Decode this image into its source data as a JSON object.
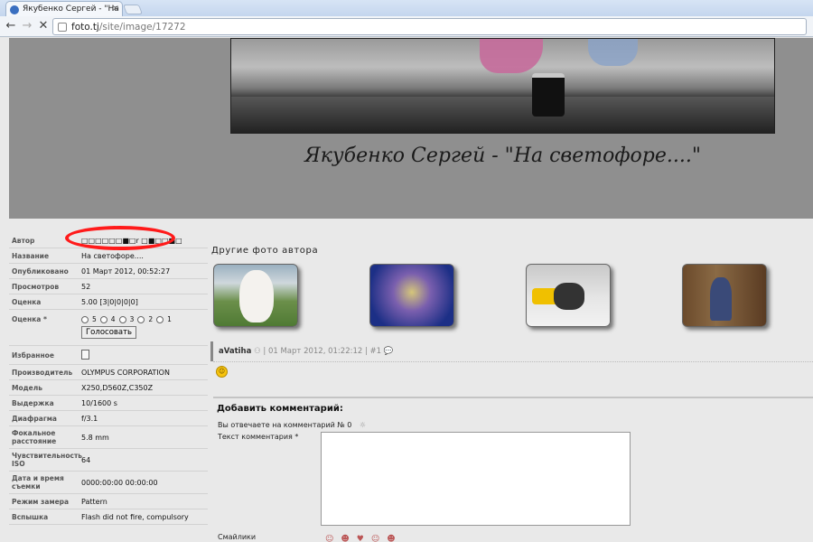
{
  "browser": {
    "tab_title": "Якубенко Сергей - \"На свето",
    "tab_close": "×",
    "url_host": "foto.tj",
    "url_path": "/site/image/17272",
    "back": "←",
    "forward": "→",
    "stop": "✕"
  },
  "banner": {
    "caption": "Якубенко Сергей - \"На светофоре....\""
  },
  "info": {
    "rows": [
      {
        "label": "Автор",
        "value": "□□□□□□■□r □■□□■□"
      },
      {
        "label": "Название",
        "value": "На светофоре...."
      },
      {
        "label": "Опубликовано",
        "value": "01 Март 2012, 00:52:27"
      },
      {
        "label": "Просмотров",
        "value": "52"
      },
      {
        "label": "Оценка",
        "value": "5.00 [3|0|0|0|0]"
      },
      {
        "label": "Оценка *",
        "value": ""
      },
      {
        "label": "Избранное",
        "value": ""
      },
      {
        "label": "Производитель",
        "value": "OLYMPUS CORPORATION"
      },
      {
        "label": "Модель",
        "value": "X250,D560Z,C350Z"
      },
      {
        "label": "Выдержка",
        "value": "10/1600 s"
      },
      {
        "label": "Диафрагма",
        "value": "f/3.1"
      },
      {
        "label": "Фокальное расстояние",
        "value": "5.8 mm"
      },
      {
        "label": "Чувствительность ISO",
        "value": "64"
      },
      {
        "label": "Дата и время съемки",
        "value": "0000:00:00 00:00:00"
      },
      {
        "label": "Режим замера",
        "value": "Pattern"
      },
      {
        "label": "Вспышка",
        "value": "Flash did not fire, compulsory"
      }
    ],
    "rating_options": [
      "5",
      "4",
      "3",
      "2",
      "1"
    ],
    "vote_button": "Голосовать"
  },
  "other_photos": {
    "title": "Другие фото автора"
  },
  "comment": {
    "user": "aVatiha",
    "date": "| 01 Март 2012, 01:22:12 |",
    "number": "#1"
  },
  "form": {
    "title": "Добавить комментарий:",
    "reply_text": "Вы отвечаете на комментарий № 0",
    "text_label": "Текст комментария *",
    "smileys_label": "Смайлики"
  }
}
